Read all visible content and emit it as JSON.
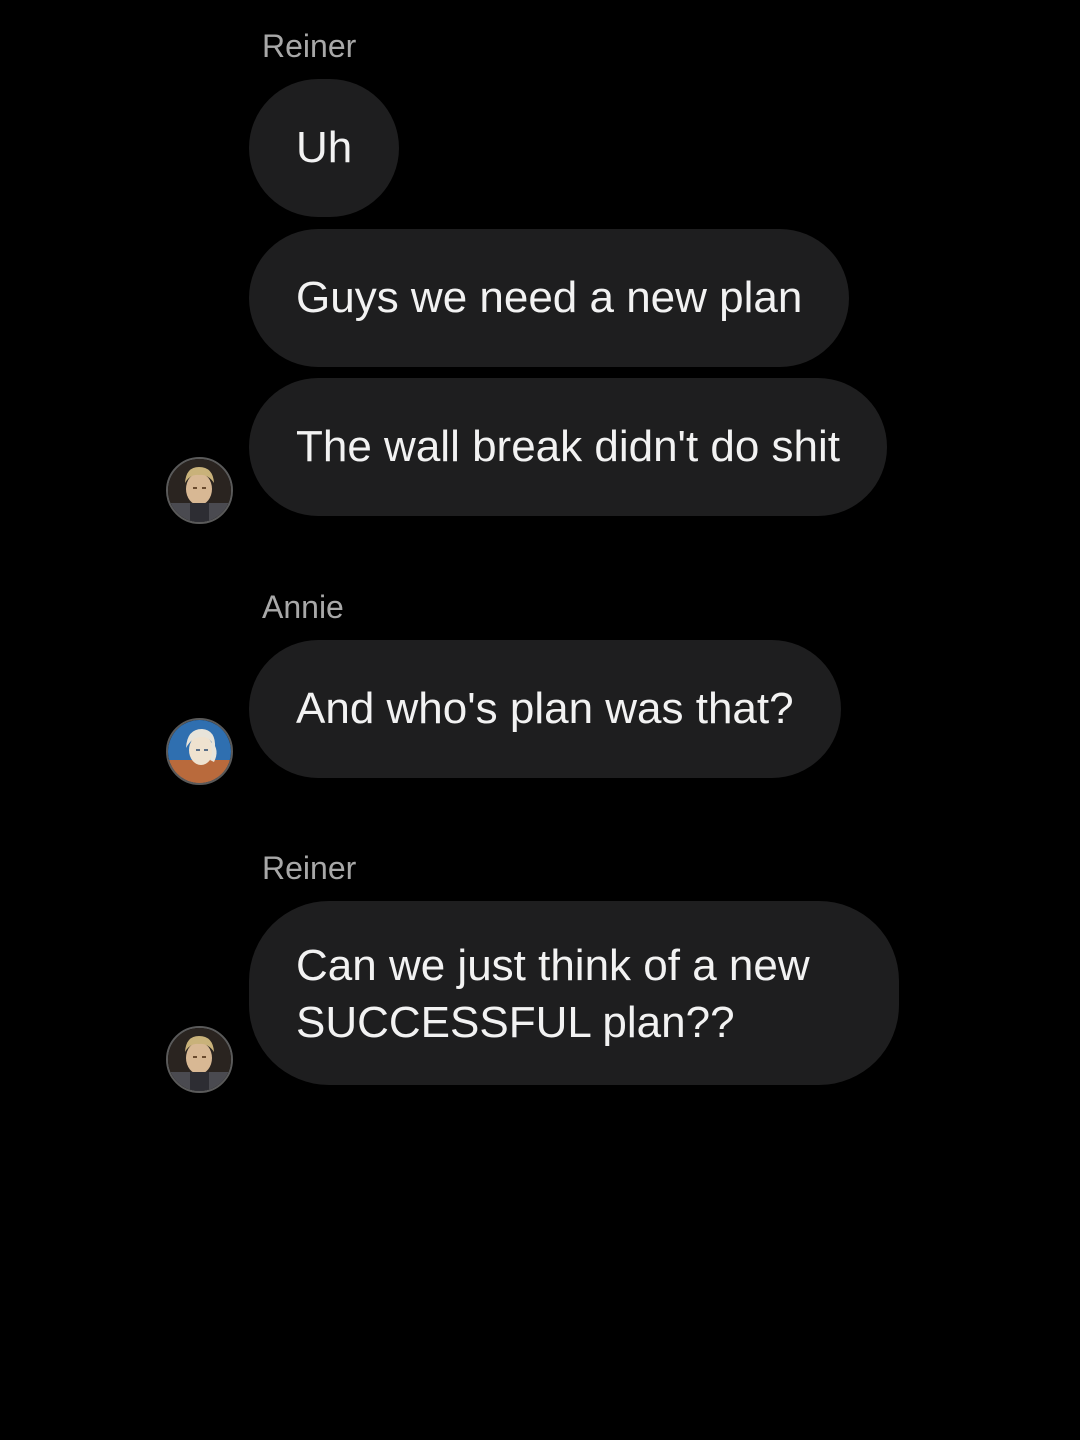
{
  "messages": [
    {
      "sender": "Reiner",
      "lines": [
        "Uh",
        "Guys we need a new plan",
        "The wall break didn't do shit"
      ]
    },
    {
      "sender": "Annie",
      "lines": [
        "And who's plan was that?"
      ]
    },
    {
      "sender": "Reiner",
      "lines": [
        "Can we just think of a new SUCCESSFUL plan??"
      ]
    }
  ],
  "avatars": {
    "reiner": {
      "icon": "reiner-avatar",
      "bg": "#2a2420",
      "hair": "#c9b27a",
      "face": "#d8b894"
    },
    "annie": {
      "icon": "annie-avatar",
      "bg": "#2f6fb0",
      "hair": "#e8e4da",
      "face": "#efe2cf"
    }
  },
  "colors": {
    "background": "#000000",
    "bubble": "#1e1e1f",
    "text": "#f2f2f2",
    "sender": "#a8a8a8"
  }
}
